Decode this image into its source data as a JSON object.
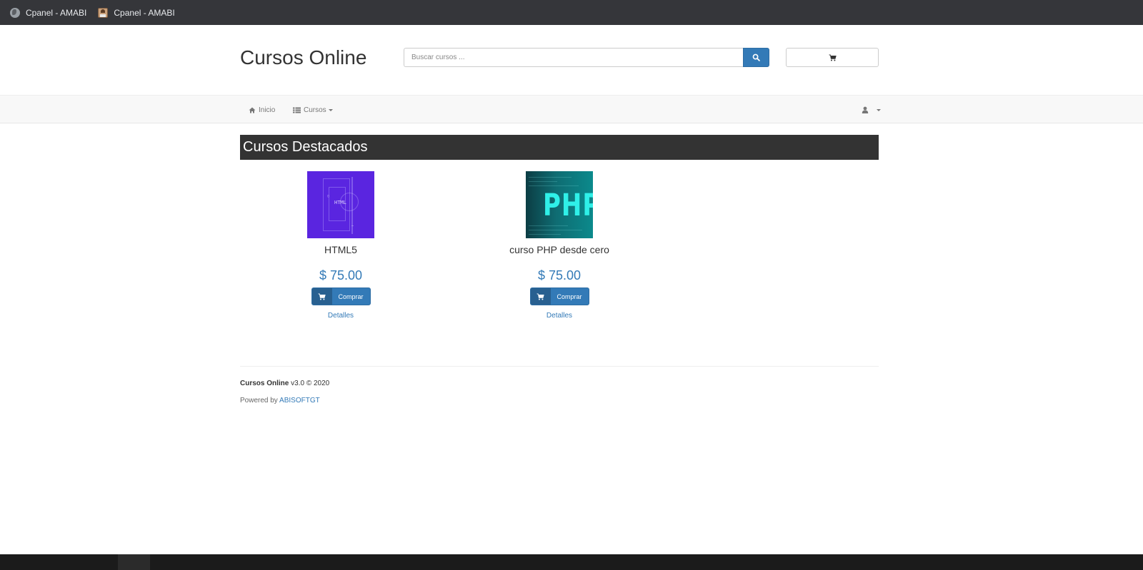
{
  "bookmarks": [
    {
      "label": "Cpanel - AMABI",
      "icon": "globe-icon"
    },
    {
      "label": "Cpanel - AMABI",
      "icon": "avatar-favicon-icon"
    }
  ],
  "header": {
    "brand": "Cursos Online",
    "search_placeholder": "Buscar cursos ...",
    "search_icon": "search-icon",
    "cart_icon": "cart-icon"
  },
  "navbar": {
    "home_label": "Inicio",
    "courses_label": "Cursos",
    "user_icon": "user-icon"
  },
  "section": {
    "title": "Cursos Destacados"
  },
  "courses": [
    {
      "title": "HTML5",
      "price": "$ 75.00",
      "buy_label": "Comprar",
      "details_label": "Detalles",
      "thumb_text": "HTML"
    },
    {
      "title": "curso PHP desde cero",
      "price": "$ 75.00",
      "buy_label": "Comprar",
      "details_label": "Detalles",
      "thumb_text": "PHP"
    }
  ],
  "footer": {
    "brand": "Cursos Online",
    "version": " v3.0 © 2020",
    "powered_prefix": "Powered by ",
    "powered_link": "ABISOFTGT"
  },
  "colors": {
    "primary": "#337ab7",
    "dark_bar": "#333333",
    "bookmarks_bar": "#35363a"
  }
}
